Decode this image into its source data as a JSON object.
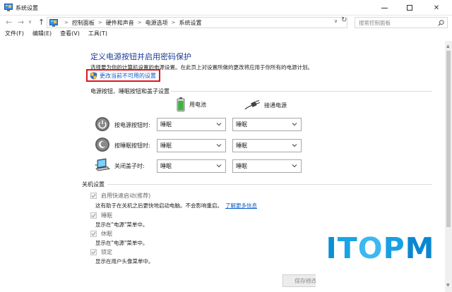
{
  "window": {
    "title": "系统设置",
    "minimize": "minimize",
    "maximize": "maximize",
    "close_glyph": "✕"
  },
  "address": {
    "back": "←",
    "forward": "→",
    "history": "∨",
    "up": "↑",
    "breadcrumbs": [
      "控制面板",
      "硬件和声音",
      "电源选项",
      "系统设置"
    ],
    "separator": ">",
    "dropdown": "∨",
    "refresh": "↻"
  },
  "search": {
    "placeholder": "搜索控制面板"
  },
  "menu": [
    {
      "label": "文件(F)"
    },
    {
      "label": "编辑(E)"
    },
    {
      "label": "查看(V)"
    },
    {
      "label": "工具(T)"
    }
  ],
  "page": {
    "heading": "定义电源按钮并启用密码保护",
    "description": "选择要为你的计算机设置的电源设置。在此页上对设置所做的更改将应用于你所有的电源计划。",
    "change_link": "更改当前不可用的设置"
  },
  "buttons_section": {
    "title": "电源按钮、睡眠按钮和盖子设置",
    "col_battery": "用电池",
    "col_plugged": "接通电源",
    "rows": [
      {
        "label": "按电源按钮时:",
        "battery": "睡眠",
        "plugged": "睡眠",
        "icon": "power-button-icon"
      },
      {
        "label": "按睡眠按钮时:",
        "battery": "睡眠",
        "plugged": "睡眠",
        "icon": "sleep-button-icon"
      },
      {
        "label": "关闭盖子时:",
        "battery": "睡眠",
        "plugged": "睡眠",
        "icon": "laptop-lid-icon"
      }
    ]
  },
  "shutdown_section": {
    "title": "关机设置",
    "items": [
      {
        "label": "启用快速启动(推荐)",
        "checked": true,
        "sub": "这有助于在关机之后更快地启动电脑。不会影响重启。",
        "link": "了解更多信息"
      },
      {
        "label": "睡眠",
        "checked": true,
        "sub": "显示在\"电源\"菜单中。"
      },
      {
        "label": "休眠",
        "checked": true,
        "sub": "显示在\"电源\"菜单中。"
      },
      {
        "label": "锁定",
        "checked": true,
        "sub": "显示在用户头像菜单中。"
      }
    ]
  },
  "footer": {
    "save": "保存修改"
  },
  "watermark": {
    "l1": "I",
    "l2": "T",
    "l3": "O",
    "l4": "P",
    "l5": "M"
  },
  "colors": {
    "heading": "#1e3c96",
    "link": "#0b5ec9",
    "highlight": "#e0141e",
    "watermark": "#0a8fd8"
  }
}
